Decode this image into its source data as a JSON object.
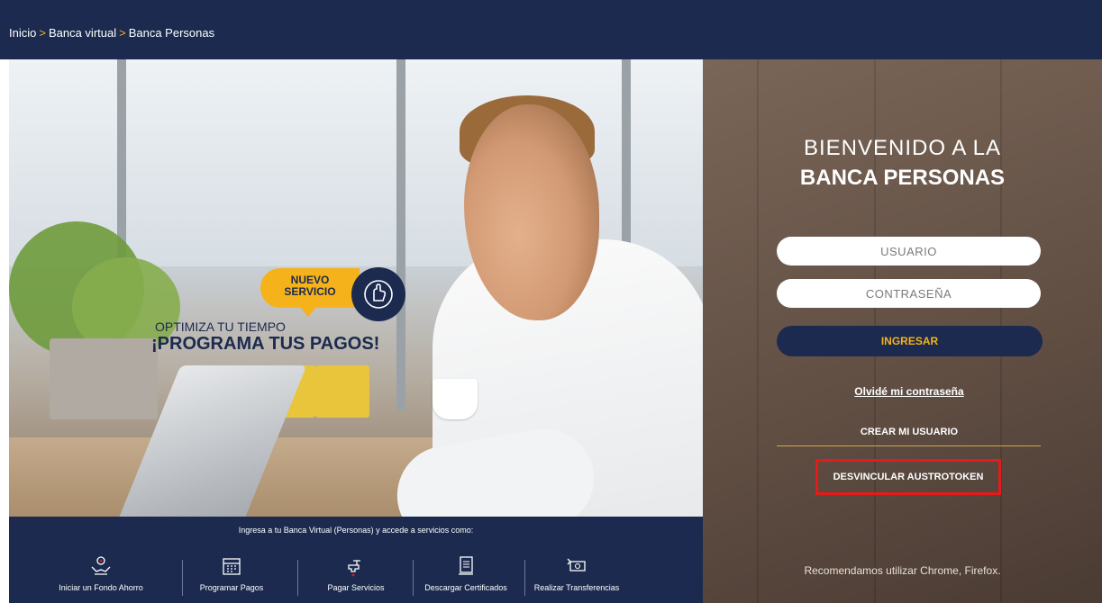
{
  "breadcrumb": {
    "items": [
      "Inicio",
      "Banca virtual",
      "Banca Personas"
    ],
    "separator": ">"
  },
  "promo": {
    "badge_line1": "NUEVO",
    "badge_line2": "SERVICIO",
    "subtitle": "OPTIMIZA TU TIEMPO",
    "title": "¡PROGRAMA TUS PAGOS!"
  },
  "services": {
    "intro": "Ingresa a tu Banca Virtual (Personas) y accede a servicios como:",
    "items": [
      {
        "label": "Iniciar un Fondo Ahorro",
        "icon": "savings-hands-icon"
      },
      {
        "label": "Programar Pagos",
        "icon": "calendar-icon"
      },
      {
        "label": "Pagar Servicios",
        "icon": "water-tap-icon"
      },
      {
        "label": "Descargar Certificados",
        "icon": "document-download-icon"
      },
      {
        "label": "Realizar Transferencias",
        "icon": "money-transfer-icon"
      }
    ]
  },
  "login": {
    "title_line1": "BIENVENIDO A LA",
    "title_line2": "BANCA PERSONAS",
    "username_placeholder": "USUARIO",
    "password_placeholder": "CONTRASEÑA",
    "submit_label": "INGRESAR",
    "forgot_label": "Olvidé mi contraseña",
    "create_label": "CREAR MI USUARIO",
    "unlink_label": "DESVINCULAR AUSTROTOKEN",
    "recommendation": "Recomendamos utilizar Chrome, Firefox."
  },
  "colors": {
    "navy": "#1b2a4e",
    "accent": "#f6b21a",
    "highlight": "#e51a1a"
  }
}
